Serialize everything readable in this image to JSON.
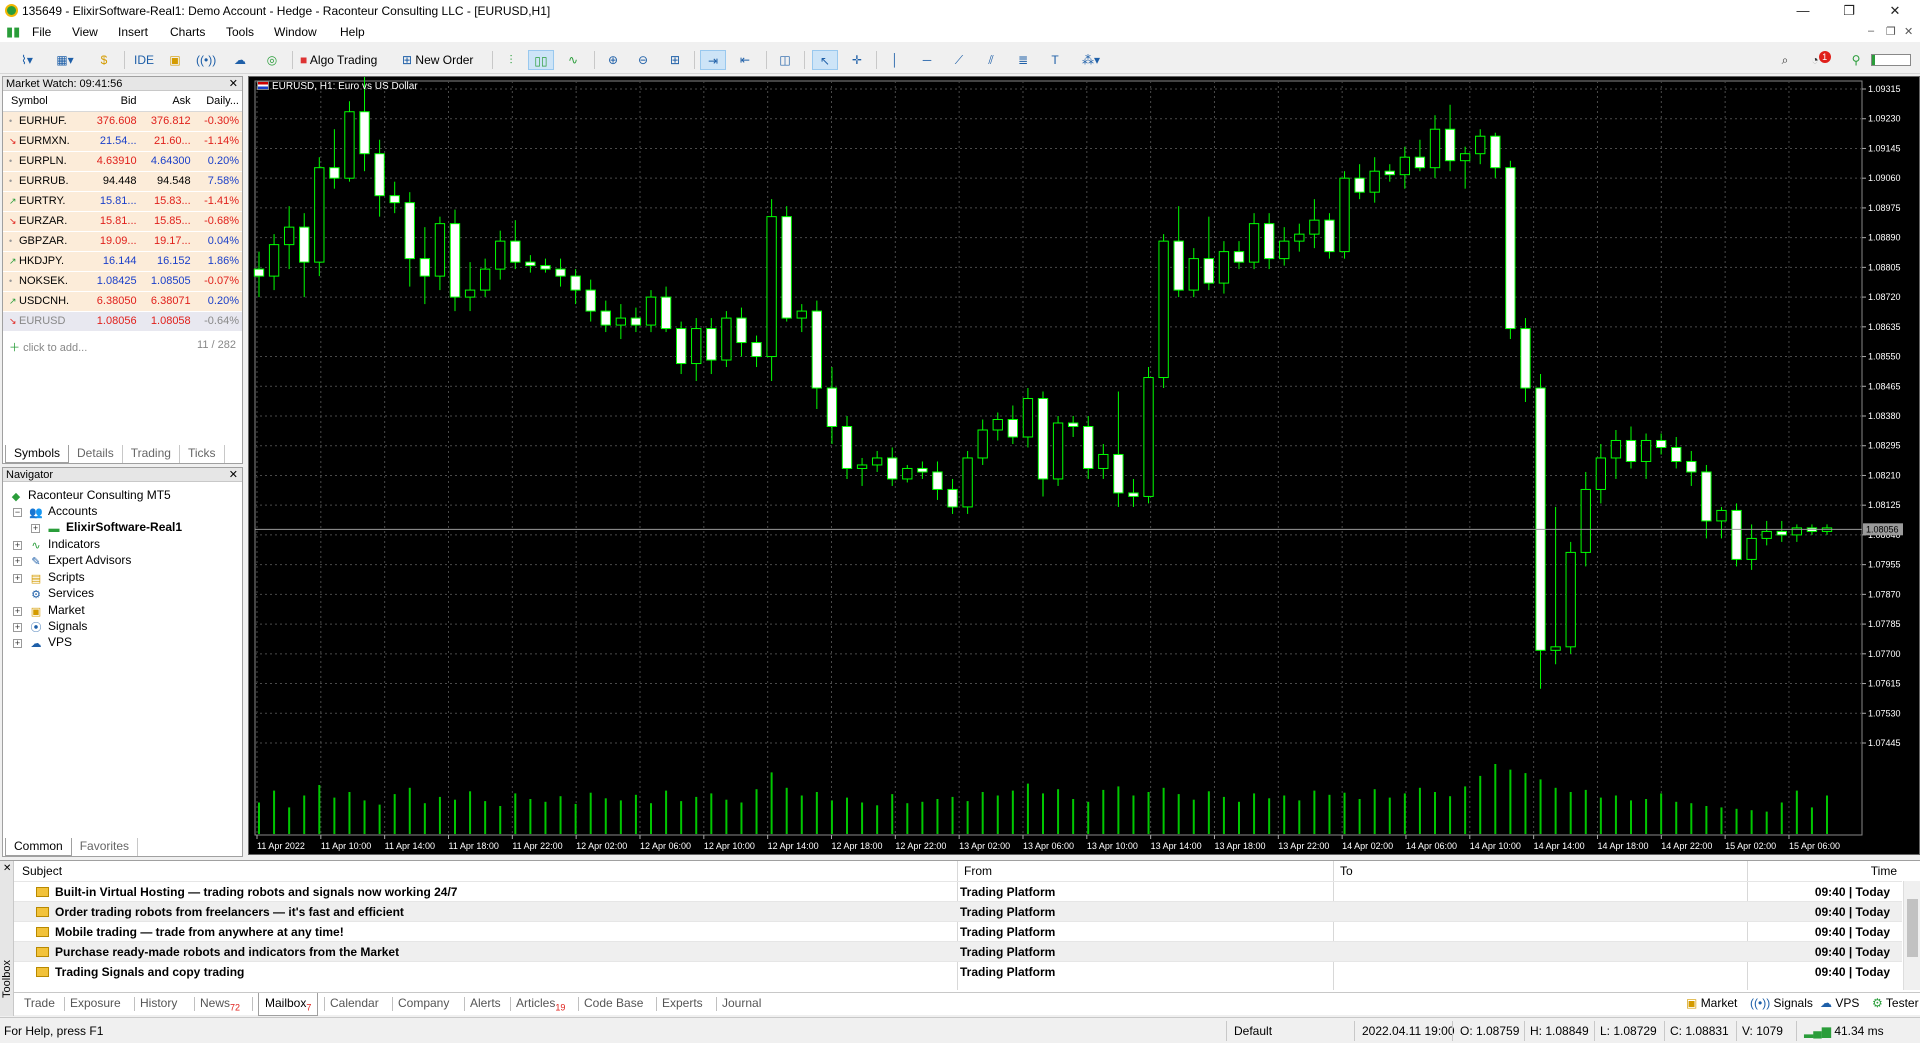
{
  "window": {
    "title": "135649 - ElixirSoftware-Real1: Demo Account - Hedge - Raconteur Consulting LLC - [EURUSD,H1]",
    "controls": {
      "minimize": "—",
      "maximize": "❐",
      "close": "✕"
    }
  },
  "menu": {
    "items": [
      "File",
      "View",
      "Insert",
      "Charts",
      "Tools",
      "Window",
      "Help"
    ],
    "mdi": {
      "minimize": "–",
      "restore": "❐",
      "close": "✕"
    }
  },
  "toolbar": {
    "ide_label": "IDE",
    "algo_trading_label": "Algo Trading",
    "new_order_label": "New Order",
    "notification_count": "1"
  },
  "market_watch": {
    "header": "Market Watch: 09:41:56",
    "columns": [
      "Symbol",
      "Bid",
      "Ask",
      "Daily..."
    ],
    "rows": [
      {
        "symbol": "EURHUF.",
        "bid": "376.608",
        "ask": "376.812",
        "daily": "-0.30%",
        "dir": "•",
        "bidc": "red",
        "askc": "red",
        "dailyc": "red"
      },
      {
        "symbol": "EURMXN.",
        "bid": "21.54...",
        "ask": "21.60...",
        "daily": "-1.14%",
        "dir": "↘",
        "bidc": "blue",
        "askc": "red",
        "dailyc": "red"
      },
      {
        "symbol": "EURPLN.",
        "bid": "4.63910",
        "ask": "4.64300",
        "daily": "0.20%",
        "dir": "•",
        "bidc": "red",
        "askc": "blue",
        "dailyc": "blue"
      },
      {
        "symbol": "EURRUB.",
        "bid": "94.448",
        "ask": "94.548",
        "daily": "7.58%",
        "dir": "•",
        "bidc": "black",
        "askc": "black",
        "dailyc": "blue"
      },
      {
        "symbol": "EURTRY.",
        "bid": "15.81...",
        "ask": "15.83...",
        "daily": "-1.41%",
        "dir": "↗",
        "bidc": "blue",
        "askc": "red",
        "dailyc": "red"
      },
      {
        "symbol": "EURZAR.",
        "bid": "15.81...",
        "ask": "15.85...",
        "daily": "-0.68%",
        "dir": "↘",
        "bidc": "red",
        "askc": "red",
        "dailyc": "red"
      },
      {
        "symbol": "GBPZAR.",
        "bid": "19.09...",
        "ask": "19.17...",
        "daily": "0.04%",
        "dir": "•",
        "bidc": "red",
        "askc": "red",
        "dailyc": "blue"
      },
      {
        "symbol": "HKDJPY.",
        "bid": "16.144",
        "ask": "16.152",
        "daily": "1.86%",
        "dir": "↗",
        "bidc": "blue",
        "askc": "blue",
        "dailyc": "blue"
      },
      {
        "symbol": "NOKSEK.",
        "bid": "1.08425",
        "ask": "1.08505",
        "daily": "-0.07%",
        "dir": "•",
        "bidc": "blue",
        "askc": "blue",
        "dailyc": "red"
      },
      {
        "symbol": "USDCNH.",
        "bid": "6.38050",
        "ask": "6.38071",
        "daily": "0.20%",
        "dir": "↗",
        "bidc": "red",
        "askc": "red",
        "dailyc": "blue"
      },
      {
        "symbol": "EURUSD",
        "bid": "1.08056",
        "ask": "1.08058",
        "daily": "-0.64%",
        "dir": "↘",
        "bidc": "red",
        "askc": "red",
        "dailyc": "red",
        "selected": true
      }
    ],
    "add_label": "click to add...",
    "count": "11 / 282",
    "tabs": [
      "Symbols",
      "Details",
      "Trading",
      "Ticks"
    ]
  },
  "navigator": {
    "header": "Navigator",
    "root": "Raconteur Consulting MT5",
    "accounts": "Accounts",
    "account_name": "ElixirSoftware-Real1",
    "items": [
      "Indicators",
      "Expert Advisors",
      "Scripts",
      "Services",
      "Market",
      "Signals",
      "VPS"
    ],
    "tabs": [
      "Common",
      "Favorites"
    ]
  },
  "chart": {
    "title": "EURUSD, H1:  Euro vs US Dollar",
    "current_price_label": "1.08056",
    "colors": {
      "background": "#000000",
      "grid": "#4a4a4a",
      "bull": "#000000",
      "bear": "#ffffff",
      "wick": "#00ff00",
      "volume": "#00c800"
    }
  },
  "chart_data": {
    "type": "candlestick",
    "symbol": "EURUSD",
    "timeframe": "H1",
    "y_ticks": [
      "1.09315",
      "1.09230",
      "1.09145",
      "1.09060",
      "1.08975",
      "1.08890",
      "1.08805",
      "1.08720",
      "1.08635",
      "1.08550",
      "1.08465",
      "1.08380",
      "1.08295",
      "1.08210",
      "1.08125",
      "1.08040",
      "1.07955",
      "1.07870",
      "1.07785",
      "1.07700",
      "1.07615",
      "1.07530",
      "1.07445"
    ],
    "x_ticks": [
      "11 Apr 2022",
      "11 Apr 10:00",
      "11 Apr 14:00",
      "11 Apr 18:00",
      "11 Apr 22:00",
      "12 Apr 02:00",
      "12 Apr 06:00",
      "12 Apr 10:00",
      "12 Apr 14:00",
      "12 Apr 18:00",
      "12 Apr 22:00",
      "13 Apr 02:00",
      "13 Apr 06:00",
      "13 Apr 10:00",
      "13 Apr 14:00",
      "13 Apr 18:00",
      "13 Apr 22:00",
      "14 Apr 02:00",
      "14 Apr 06:00",
      "14 Apr 10:00",
      "14 Apr 14:00",
      "14 Apr 18:00",
      "14 Apr 22:00",
      "15 Apr 02:00",
      "15 Apr 06:00"
    ],
    "ylim": [
      1.0742,
      1.0936
    ],
    "candles": [
      [
        1.088,
        1.0885,
        1.0872,
        1.0878
      ],
      [
        1.0878,
        1.089,
        1.0874,
        1.0887
      ],
      [
        1.0887,
        1.0898,
        1.088,
        1.0892
      ],
      [
        1.0892,
        1.0896,
        1.0872,
        1.0882
      ],
      [
        1.0882,
        1.0912,
        1.0878,
        1.0909
      ],
      [
        1.0909,
        1.092,
        1.0903,
        1.0906
      ],
      [
        1.0906,
        1.0928,
        1.0905,
        1.0925
      ],
      [
        1.0925,
        1.0935,
        1.0908,
        1.0913
      ],
      [
        1.0913,
        1.0917,
        1.0895,
        1.0901
      ],
      [
        1.0901,
        1.0905,
        1.0896,
        1.0899
      ],
      [
        1.0899,
        1.0902,
        1.0875,
        1.0883
      ],
      [
        1.0883,
        1.0892,
        1.087,
        1.0878
      ],
      [
        1.0878,
        1.0895,
        1.0874,
        1.0893
      ],
      [
        1.0893,
        1.0897,
        1.0868,
        1.0872
      ],
      [
        1.0872,
        1.0882,
        1.0868,
        1.0874
      ],
      [
        1.0874,
        1.0883,
        1.0872,
        1.088
      ],
      [
        1.088,
        1.0891,
        1.0877,
        1.0888
      ],
      [
        1.0888,
        1.0894,
        1.088,
        1.0882
      ],
      [
        1.0882,
        1.0884,
        1.0879,
        1.0881
      ],
      [
        1.0881,
        1.0883,
        1.0879,
        1.088
      ],
      [
        1.088,
        1.0883,
        1.0875,
        1.0878
      ],
      [
        1.0878,
        1.088,
        1.087,
        1.0874
      ],
      [
        1.0874,
        1.0877,
        1.0865,
        1.0868
      ],
      [
        1.0868,
        1.0871,
        1.0862,
        1.0864
      ],
      [
        1.0864,
        1.087,
        1.086,
        1.0866
      ],
      [
        1.0866,
        1.0869,
        1.0862,
        1.0864
      ],
      [
        1.0864,
        1.0874,
        1.0862,
        1.0872
      ],
      [
        1.0872,
        1.0875,
        1.0862,
        1.0863
      ],
      [
        1.0863,
        1.0865,
        1.085,
        1.0853
      ],
      [
        1.0853,
        1.0866,
        1.0848,
        1.0863
      ],
      [
        1.0863,
        1.0866,
        1.085,
        1.0854
      ],
      [
        1.0854,
        1.0868,
        1.0852,
        1.0866
      ],
      [
        1.0866,
        1.0869,
        1.0855,
        1.0859
      ],
      [
        1.0859,
        1.0861,
        1.0852,
        1.0855
      ],
      [
        1.0855,
        1.09,
        1.0848,
        1.0895
      ],
      [
        1.0895,
        1.0898,
        1.0865,
        1.0866
      ],
      [
        1.0866,
        1.087,
        1.0862,
        1.0868
      ],
      [
        1.0868,
        1.0871,
        1.084,
        1.0846
      ],
      [
        1.0846,
        1.0852,
        1.083,
        1.0835
      ],
      [
        1.0835,
        1.0838,
        1.082,
        1.0823
      ],
      [
        1.0823,
        1.0826,
        1.0818,
        1.0824
      ],
      [
        1.0824,
        1.0828,
        1.0822,
        1.0826
      ],
      [
        1.0826,
        1.0829,
        1.0818,
        1.082
      ],
      [
        1.082,
        1.0824,
        1.0819,
        1.0823
      ],
      [
        1.0823,
        1.0825,
        1.082,
        1.0822
      ],
      [
        1.0822,
        1.0825,
        1.0814,
        1.0817
      ],
      [
        1.0817,
        1.082,
        1.081,
        1.0812
      ],
      [
        1.0812,
        1.0828,
        1.081,
        1.0826
      ],
      [
        1.0826,
        1.0837,
        1.0824,
        1.0834
      ],
      [
        1.0834,
        1.0839,
        1.0831,
        1.0837
      ],
      [
        1.0837,
        1.0841,
        1.083,
        1.0832
      ],
      [
        1.0832,
        1.0846,
        1.0829,
        1.0843
      ],
      [
        1.0843,
        1.0845,
        1.0815,
        1.082
      ],
      [
        1.082,
        1.0838,
        1.0818,
        1.0836
      ],
      [
        1.0836,
        1.0838,
        1.0832,
        1.0835
      ],
      [
        1.0835,
        1.0838,
        1.082,
        1.0823
      ],
      [
        1.0823,
        1.083,
        1.082,
        1.0827
      ],
      [
        1.0827,
        1.0845,
        1.0812,
        1.0816
      ],
      [
        1.0816,
        1.082,
        1.0812,
        1.0815
      ],
      [
        1.0815,
        1.0852,
        1.0813,
        1.0849
      ],
      [
        1.0849,
        1.089,
        1.0846,
        1.0888
      ],
      [
        1.0888,
        1.0898,
        1.0872,
        1.0874
      ],
      [
        1.0874,
        1.0886,
        1.0872,
        1.0883
      ],
      [
        1.0883,
        1.0895,
        1.0874,
        1.0876
      ],
      [
        1.0876,
        1.0888,
        1.0873,
        1.0885
      ],
      [
        1.0885,
        1.0888,
        1.088,
        1.0882
      ],
      [
        1.0882,
        1.0896,
        1.088,
        1.0893
      ],
      [
        1.0893,
        1.0896,
        1.088,
        1.0883
      ],
      [
        1.0883,
        1.0892,
        1.0881,
        1.0888
      ],
      [
        1.0888,
        1.0893,
        1.0885,
        1.089
      ],
      [
        1.089,
        1.09,
        1.0886,
        1.0894
      ],
      [
        1.0894,
        1.0896,
        1.0883,
        1.0885
      ],
      [
        1.0885,
        1.0908,
        1.0883,
        1.0906
      ],
      [
        1.0906,
        1.091,
        1.09,
        1.0902
      ],
      [
        1.0902,
        1.0912,
        1.0899,
        1.0908
      ],
      [
        1.0908,
        1.091,
        1.0905,
        1.0907
      ],
      [
        1.0907,
        1.0915,
        1.0903,
        1.0912
      ],
      [
        1.0912,
        1.0917,
        1.0908,
        1.0909
      ],
      [
        1.0909,
        1.0924,
        1.0906,
        1.092
      ],
      [
        1.092,
        1.0927,
        1.0908,
        1.0911
      ],
      [
        1.0911,
        1.0915,
        1.0903,
        1.0913
      ],
      [
        1.0913,
        1.092,
        1.091,
        1.0918
      ],
      [
        1.0918,
        1.0919,
        1.0906,
        1.0909
      ],
      [
        1.0909,
        1.0911,
        1.086,
        1.0863
      ],
      [
        1.0863,
        1.0866,
        1.0842,
        1.0846
      ],
      [
        1.0846,
        1.085,
        1.076,
        1.0771
      ],
      [
        1.0771,
        1.0812,
        1.0767,
        1.0772
      ],
      [
        1.0772,
        1.0802,
        1.077,
        1.0799
      ],
      [
        1.0799,
        1.0822,
        1.0795,
        1.0817
      ],
      [
        1.0817,
        1.083,
        1.0813,
        1.0826
      ],
      [
        1.0826,
        1.0834,
        1.082,
        1.0831
      ],
      [
        1.0831,
        1.0835,
        1.0823,
        1.0825
      ],
      [
        1.0825,
        1.0833,
        1.082,
        1.0831
      ],
      [
        1.0831,
        1.0833,
        1.0827,
        1.0829
      ],
      [
        1.0829,
        1.0832,
        1.0823,
        1.0825
      ],
      [
        1.0825,
        1.0828,
        1.0818,
        1.0822
      ],
      [
        1.0822,
        1.0824,
        1.0803,
        1.0808
      ],
      [
        1.0808,
        1.0812,
        1.0803,
        1.0811
      ],
      [
        1.0811,
        1.0813,
        1.0795,
        1.0797
      ],
      [
        1.0797,
        1.0807,
        1.0794,
        1.0803
      ],
      [
        1.0803,
        1.0808,
        1.0801,
        1.0805
      ],
      [
        1.0805,
        1.0808,
        1.0802,
        1.0804
      ],
      [
        1.0804,
        1.0807,
        1.0802,
        1.0806
      ],
      [
        1.0806,
        1.0807,
        1.0804,
        1.0805
      ],
      [
        1.0805,
        1.0807,
        1.0804,
        1.0806
      ]
    ],
    "volumes": [
      0.45,
      0.62,
      0.38,
      0.55,
      0.7,
      0.52,
      0.6,
      0.48,
      0.42,
      0.57,
      0.66,
      0.44,
      0.53,
      0.49,
      0.61,
      0.47,
      0.4,
      0.58,
      0.5,
      0.46,
      0.54,
      0.43,
      0.59,
      0.51,
      0.48,
      0.56,
      0.44,
      0.62,
      0.47,
      0.53,
      0.58,
      0.49,
      0.45,
      0.64,
      0.88,
      0.66,
      0.55,
      0.6,
      0.48,
      0.52,
      0.45,
      0.41,
      0.57,
      0.44,
      0.46,
      0.5,
      0.53,
      0.47,
      0.6,
      0.55,
      0.62,
      0.72,
      0.58,
      0.64,
      0.5,
      0.46,
      0.63,
      0.68,
      0.55,
      0.6,
      0.66,
      0.57,
      0.49,
      0.61,
      0.53,
      0.46,
      0.58,
      0.51,
      0.55,
      0.48,
      0.62,
      0.56,
      0.59,
      0.5,
      0.64,
      0.52,
      0.58,
      0.66,
      0.6,
      0.54,
      0.68,
      0.83,
      1.0,
      0.92,
      0.87,
      0.78,
      0.66,
      0.6,
      0.63,
      0.52,
      0.55,
      0.48,
      0.5,
      0.58,
      0.46,
      0.44,
      0.4,
      0.38,
      0.36,
      0.34,
      0.32
    ],
    "current_price": 1.08056
  },
  "toolbox": {
    "side_label": "Toolbox",
    "columns": [
      "Subject",
      "From",
      "To",
      "Time"
    ],
    "messages": [
      {
        "subject": "Built-in Virtual Hosting — trading robots and signals now working 24/7",
        "from": "Trading Platform",
        "time": "09:40 | Today"
      },
      {
        "subject": "Order trading robots from freelancers — it's fast and efficient",
        "from": "Trading Platform",
        "time": "09:40 | Today"
      },
      {
        "subject": "Mobile trading — trade from anywhere at any time!",
        "from": "Trading Platform",
        "time": "09:40 | Today"
      },
      {
        "subject": "Purchase ready-made robots and indicators from the Market",
        "from": "Trading Platform",
        "time": "09:40 | Today"
      },
      {
        "subject": "Trading Signals and copy trading",
        "from": "Trading Platform",
        "time": "09:40 | Today"
      }
    ],
    "tabs": [
      {
        "label": "Trade"
      },
      {
        "label": "Exposure"
      },
      {
        "label": "History"
      },
      {
        "label": "News",
        "badge": "72"
      },
      {
        "label": "Mailbox",
        "badge": "7",
        "active": true
      },
      {
        "label": "Calendar"
      },
      {
        "label": "Company"
      },
      {
        "label": "Alerts"
      },
      {
        "label": "Articles",
        "badge": "19"
      },
      {
        "label": "Code Base"
      },
      {
        "label": "Experts"
      },
      {
        "label": "Journal"
      }
    ],
    "right_tabs": [
      "Market",
      "Signals",
      "VPS",
      "Tester"
    ]
  },
  "status": {
    "help": "For Help, press F1",
    "profile": "Default",
    "datetime": "2022.04.11 19:00",
    "open": "O: 1.08759",
    "high": "H: 1.08849",
    "low": "L: 1.08729",
    "close": "C: 1.08831",
    "volume": "V: 1079",
    "ping": "41.34 ms"
  }
}
